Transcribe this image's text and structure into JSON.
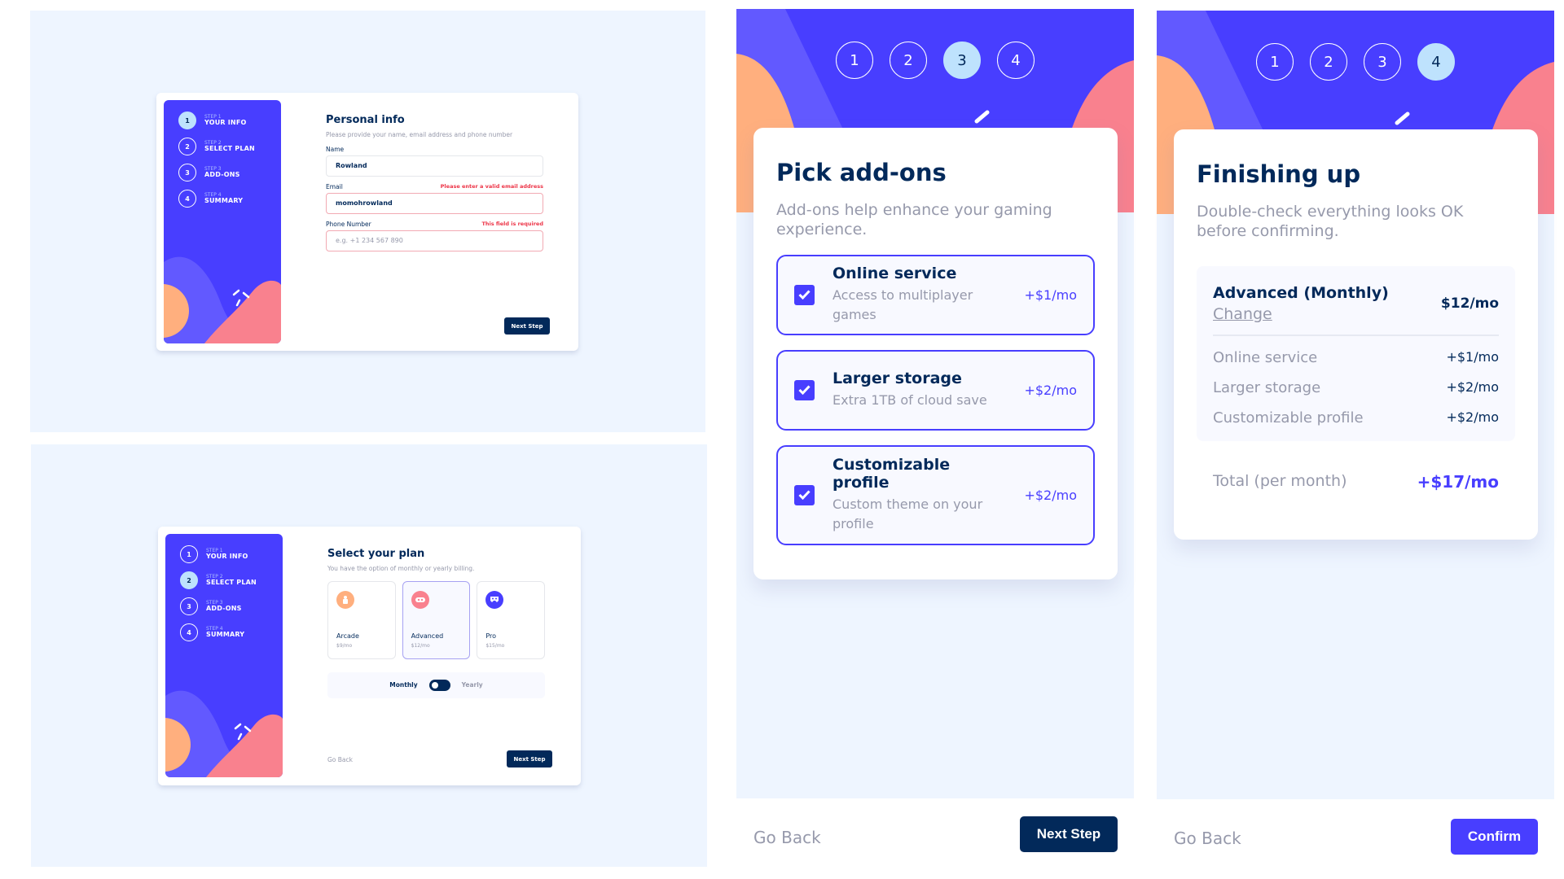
{
  "colors": {
    "primary": "#483eff",
    "navy": "#02295a",
    "light_blue": "#bee2fd",
    "error": "#ed3548",
    "gray": "#9699ab",
    "background": "#eef5ff",
    "orange": "#ffaf7e",
    "pink": "#f9818e"
  },
  "sidebar_steps": [
    {
      "number": "1",
      "small": "STEP 1",
      "label": "YOUR INFO"
    },
    {
      "number": "2",
      "small": "STEP 2",
      "label": "SELECT PLAN"
    },
    {
      "number": "3",
      "small": "STEP 3",
      "label": "ADD-ONS"
    },
    {
      "number": "4",
      "small": "STEP 4",
      "label": "SUMMARY"
    }
  ],
  "personal_info": {
    "title": "Personal info",
    "subtitle": "Please provide your name, email address and phone number",
    "fields": [
      {
        "label": "Name",
        "value": "Rowland",
        "placeholder": "",
        "error": ""
      },
      {
        "label": "Email",
        "value": "momohrowland",
        "placeholder": "",
        "error": "Please enter a valid email address"
      },
      {
        "label": "Phone Number",
        "value": "",
        "placeholder": "e.g. +1 234 567 890",
        "error": "This field is required"
      }
    ],
    "next_label": "Next Step"
  },
  "select_plan": {
    "title": "Select your plan",
    "subtitle": "You have the option of monthly or yearly billing.",
    "plans": [
      {
        "name": "Arcade",
        "price": "$9/mo",
        "icon": "arcade-icon",
        "color": "#ffaf7e",
        "selected": false
      },
      {
        "name": "Advanced",
        "price": "$12/mo",
        "icon": "advanced-icon",
        "color": "#f9818e",
        "selected": true
      },
      {
        "name": "Pro",
        "price": "$15/mo",
        "icon": "pro-icon",
        "color": "#483eff",
        "selected": false
      }
    ],
    "billing_monthly": "Monthly",
    "billing_yearly": "Yearly",
    "billing_selected": "Monthly",
    "back_label": "Go Back",
    "next_label": "Next Step"
  },
  "mobile_steps": [
    "1",
    "2",
    "3",
    "4"
  ],
  "addons": {
    "active_step": "3",
    "title": "Pick add-ons",
    "subtitle": "Add-ons help enhance your gaming experience.",
    "items": [
      {
        "name": "Online service",
        "desc": "Access to multiplayer games",
        "price": "+$1/mo",
        "checked": true
      },
      {
        "name": "Larger storage",
        "desc": "Extra 1TB of cloud save",
        "price": "+$2/mo",
        "checked": true
      },
      {
        "name": "Customizable profile",
        "desc": "Custom theme on your profile",
        "price": "+$2/mo",
        "checked": true
      }
    ],
    "back_label": "Go Back",
    "next_label": "Next Step"
  },
  "summary": {
    "active_step": "4",
    "title": "Finishing up",
    "subtitle": "Double-check everything looks OK before confirming.",
    "plan_name": "Advanced (Monthly)",
    "change_label": "Change",
    "plan_price": "$12/mo",
    "addons": [
      {
        "name": "Online service",
        "price": "+$1/mo"
      },
      {
        "name": "Larger storage",
        "price": "+$2/mo"
      },
      {
        "name": "Customizable profile",
        "price": "+$2/mo"
      }
    ],
    "total_label": "Total (per month)",
    "total_price": "+$17/mo",
    "back_label": "Go Back",
    "confirm_label": "Confirm"
  }
}
